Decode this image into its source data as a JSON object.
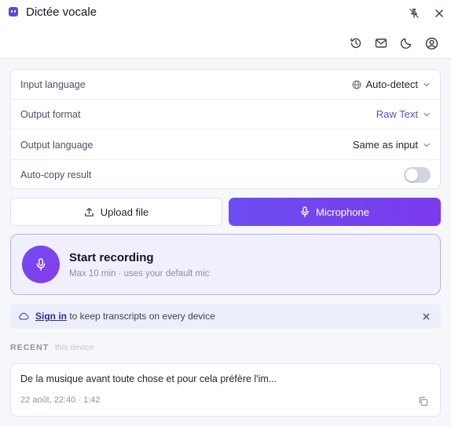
{
  "window": {
    "title": "Dictée vocale",
    "icons": {
      "app": "app-logo-icon",
      "unpin": "unpin-icon",
      "close": "close-icon"
    }
  },
  "toolbar": {
    "icons": [
      "history-icon",
      "mail-icon",
      "moon-icon",
      "user-circle-icon"
    ]
  },
  "settings": {
    "input_language": {
      "label": "Input language",
      "value": "Auto-detect",
      "icon": "globe-icon"
    },
    "output_format": {
      "label": "Output format",
      "value": "Raw Text"
    },
    "output_language": {
      "label": "Output language",
      "value": "Same as input"
    },
    "auto_copy": {
      "label": "Auto-copy result",
      "enabled": false
    }
  },
  "source": {
    "upload_label": "Upload file",
    "microphone_label": "Microphone",
    "active": "microphone"
  },
  "recording": {
    "title": "Start recording",
    "subtitle": "Max 10 min · uses your default mic"
  },
  "banner": {
    "link": "Sign in",
    "text": " to keep transcripts on every device"
  },
  "recent": {
    "label": "RECENT",
    "sublabel": "this device",
    "items": [
      {
        "text": "De la musique avant toute chose et pour cela préfère l'im...",
        "meta": "22 août, 22:40 · 1:42"
      }
    ]
  },
  "colors": {
    "accent": "#5b4bd6",
    "accent_gradient_start": "#6b4df0",
    "accent_gradient_end": "#7c3aed"
  }
}
